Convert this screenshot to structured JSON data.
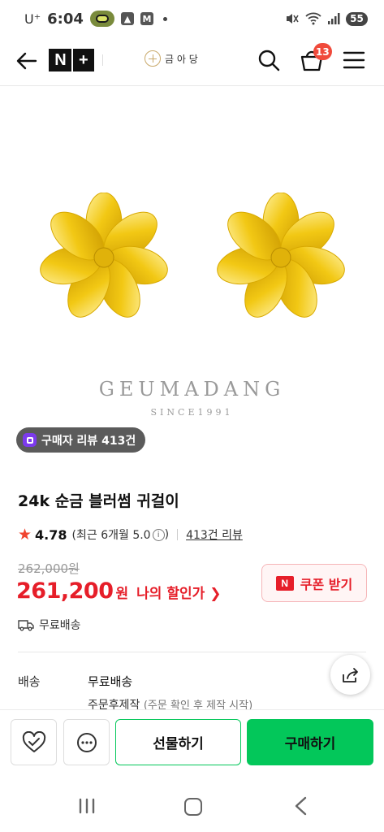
{
  "status_bar": {
    "carrier": "U⁺",
    "time": "6:04",
    "app_icon_1": "M",
    "battery": "55"
  },
  "header": {
    "store_name": "금 아 당",
    "cart_count": "13",
    "nplus_label_n": "N",
    "nplus_label_plus": "+"
  },
  "product_image": {
    "brand": "GEUMADANG",
    "since": "SINCE1991",
    "review_chip": "구매자 리뷰 413건"
  },
  "product": {
    "title": "24k 순금 블러썸 귀걸이",
    "rating": "4.78",
    "rating_recent": "(최근 6개월 5.0",
    "rating_recent_close": ")",
    "review_count": "413건 리뷰",
    "original_price": "262,000원",
    "sale_price": "261,200",
    "won": "원",
    "my_discount": "나의 할인가",
    "coupon_label": "쿠폰 받기",
    "coupon_logo": "N",
    "shipping": "무료배송"
  },
  "details": {
    "label": "배송",
    "value": "무료배송",
    "sub": "주문후제작",
    "sub_note": "(주문 확인 후 제작 시작)"
  },
  "actions": {
    "gift": "선물하기",
    "buy": "구매하기"
  },
  "colors": {
    "accent_green": "#03c75a",
    "price_red": "#e61e29",
    "badge_red": "#f04a3b",
    "gold": "#f2c814"
  },
  "icons": [
    "back-arrow-icon",
    "search-icon",
    "shopping-bag-icon",
    "menu-icon",
    "star-icon",
    "info-icon",
    "truck-icon",
    "share-icon",
    "heart-check-icon",
    "chat-icon"
  ]
}
